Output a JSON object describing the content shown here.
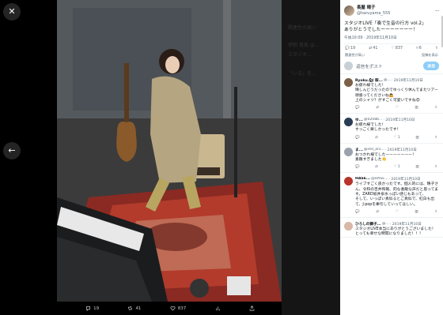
{
  "viewer": {
    "actions": {
      "replies": "19",
      "reposts": "41",
      "likes": "837"
    },
    "ghost_lines": [
      "関連性の高い",
      "伊田 真美 @...",
      "スタジオ...",
      "「いま」を..."
    ]
  },
  "post": {
    "author_name": "長屋 晴子",
    "author_handle": "@haruyama_555",
    "text_line1": "スタジオLIVE「奏で生音の行方 vol.2」",
    "text_line2": "ありがとうでしたーーーーーーー！",
    "time": "午後10:09 · 2019年11月10日",
    "stats": {
      "replies": "19",
      "reposts": "41",
      "likes": "837",
      "bookmarks": "6"
    },
    "links": {
      "related": "関連性が高い",
      "embed": "投稿を表示"
    },
    "reply_placeholder": "返信をポスト",
    "reply_button": "返信"
  },
  "replies": [
    {
      "name": "Ryoku.🐿 稼...",
      "handle": "@...",
      "date": "· 2019年11月10日",
      "text": "お疲れ様でした！\n晴しんどうだったのでゆっくり休んでまたツアー頑張ってくださいね🙇\n上のシャツ？がすごく可愛いですね😍",
      "reply": "",
      "repost": "",
      "like": "",
      "views": ""
    },
    {
      "name": "ゆ...",
      "handle": "@0208b...",
      "date": "· 2019年11月10日",
      "text": "お疲れ様でした！\nすっごく楽しかったです！",
      "reply": "",
      "repost": "",
      "like": "1",
      "views": ""
    },
    {
      "name": "ま...",
      "handle": "@red_ars...",
      "date": "· 2019年11月10日",
      "text": "おつかれ様でしたーーーーーーー！\n素敵すぎました👏",
      "reply": "",
      "repost": "",
      "like": "1",
      "views": ""
    },
    {
      "name": "HASE...",
      "handle": "@HASE...",
      "date": "· 2019年11月10日",
      "text": "ライブすごく良かったです。個人的には、晴子さん、令和の吉井和哉、的な素敵な声だと思ってます。ZARD坂井泉水っぽい感じもあって、\nそして、いっぱい真似るとご真似で、紅白も出て、J-popを牽引していってほしい。",
      "reply": "",
      "repost": "",
      "like": "",
      "views": ""
    },
    {
      "name": "ひろしの獅子...",
      "handle": "@...",
      "date": "· 2019年11月10日",
      "text": "スタジオLIVE本当にありがとうございました！\nとっても幸せな時間になりました！！！",
      "reply": "",
      "repost": "",
      "like": "",
      "views": ""
    }
  ],
  "colors": {
    "accent": "#1d9bf0",
    "reply_button": "#8ecdf8",
    "muted": "#536471"
  }
}
